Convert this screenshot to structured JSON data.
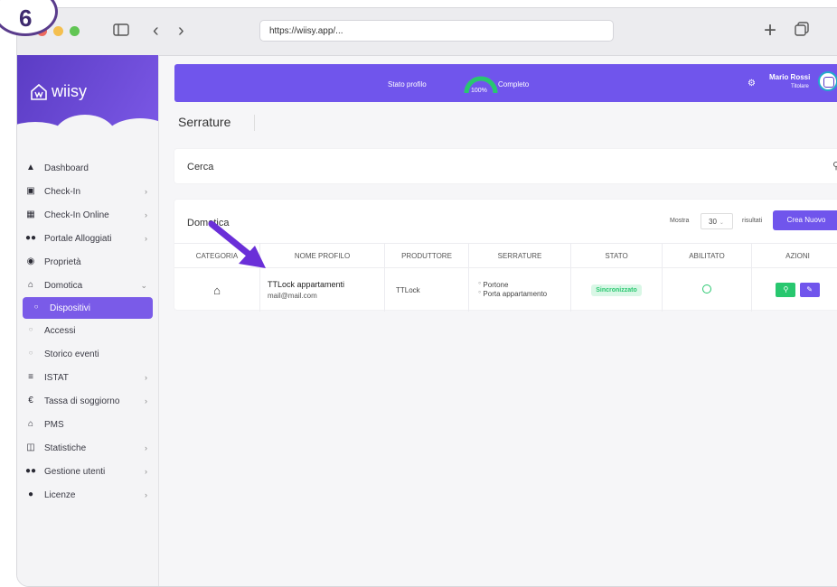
{
  "step_number": "6",
  "browser": {
    "url": "https://wiisy.app/..."
  },
  "sidebar": {
    "logo": "wiisy",
    "items": [
      {
        "label": "Dashboard",
        "icon": "home-icon",
        "chevron": ""
      },
      {
        "label": "Check-In",
        "icon": "clipboard-icon",
        "chevron": ">"
      },
      {
        "label": "Check-In Online",
        "icon": "calendar-icon",
        "chevron": ">"
      },
      {
        "label": "Portale Alloggiati",
        "icon": "users-icon",
        "chevron": ">"
      },
      {
        "label": "Proprietà",
        "icon": "map-pin-icon",
        "chevron": ""
      },
      {
        "label": "Domotica",
        "icon": "smart-home-icon",
        "chevron": "v"
      },
      {
        "label": "Dispositivi",
        "icon": "circle-icon",
        "chevron": ""
      },
      {
        "label": "Accessi",
        "icon": "circle-icon",
        "chevron": ""
      },
      {
        "label": "Storico eventi",
        "icon": "circle-icon",
        "chevron": ""
      },
      {
        "label": "ISTAT",
        "icon": "bar-chart-icon",
        "chevron": ">"
      },
      {
        "label": "Tassa di soggiorno",
        "icon": "euro-icon",
        "chevron": ">"
      },
      {
        "label": "PMS",
        "icon": "house-icon",
        "chevron": ""
      },
      {
        "label": "Statistiche",
        "icon": "table-icon",
        "chevron": ">"
      },
      {
        "label": "Gestione utenti",
        "icon": "users-icon",
        "chevron": ">"
      },
      {
        "label": "Licenze",
        "icon": "user-key-icon",
        "chevron": ">"
      }
    ]
  },
  "banner": {
    "profile_label": "Stato profilo",
    "percent": "100%",
    "progress": 1.0,
    "status": "Completo",
    "user_name": "Mario Rossi",
    "user_role": "Titolare"
  },
  "page": {
    "title": "Serrature"
  },
  "search": {
    "label": "Cerca"
  },
  "table": {
    "title": "Domotica",
    "show_label": "Mostra",
    "page_size": "30",
    "results_label": "risultati",
    "new_button": "Crea Nuovo",
    "headers": [
      "CATEGORIA",
      "NOME PROFILO",
      "PRODUTTORE",
      "SERRATURE",
      "STATO",
      "ABILITATO",
      "AZIONI"
    ],
    "rows": [
      {
        "profile_name": "TTLock appartamenti",
        "email": "mail@mail.com",
        "manufacturer": "TTLock",
        "locks": [
          "Portone",
          "Porta appartamento"
        ],
        "status": "Sincronizzato"
      }
    ]
  },
  "colors": {
    "accent": "#7055ec",
    "green": "#28c76f",
    "status_bg": "#d9f7e6",
    "arrow": "#6a2fd8"
  }
}
